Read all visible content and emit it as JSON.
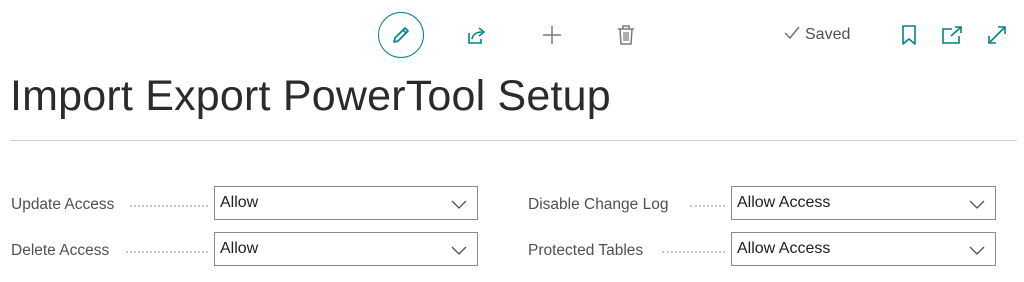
{
  "toolbar": {
    "edit_icon": "pencil-icon",
    "share_icon": "share-icon",
    "new_icon": "plus-icon",
    "delete_icon": "trash-icon",
    "saved_label": "Saved",
    "saved_icon": "checkmark-icon",
    "bookmark_icon": "bookmark-icon",
    "open_new_window_icon": "open-in-new-window-icon",
    "expand_icon": "expand-icon"
  },
  "page": {
    "title": "Import Export PowerTool Setup"
  },
  "fields": {
    "update_access": {
      "label": "Update Access",
      "value": "Allow"
    },
    "delete_access": {
      "label": "Delete Access",
      "value": "Allow"
    },
    "disable_change_log": {
      "label": "Disable Change Log",
      "value": "Allow Access"
    },
    "protected_tables": {
      "label": "Protected Tables",
      "value": "Allow Access"
    }
  },
  "colors": {
    "accent": "#00838a",
    "text": "#212121",
    "label": "#505050",
    "border": "#8a8a8a"
  }
}
